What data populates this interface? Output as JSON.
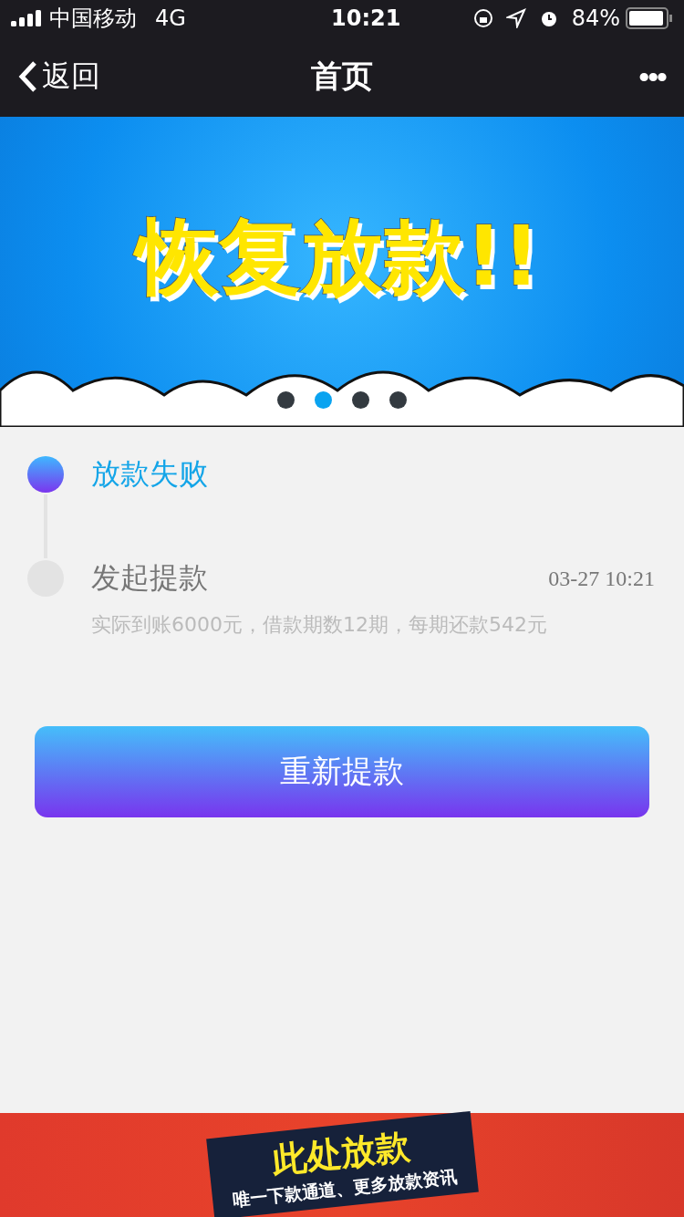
{
  "status_bar": {
    "carrier": "中国移动",
    "network": "4G",
    "time": "10:21",
    "battery": "84%"
  },
  "nav": {
    "back": "返回",
    "title": "首页",
    "more": "•••"
  },
  "banner": {
    "headline": "恢复放款!!",
    "dots": [
      {
        "selected": false
      },
      {
        "selected": true
      },
      {
        "selected": false
      },
      {
        "selected": false
      }
    ]
  },
  "timeline": [
    {
      "title": "放款失败",
      "active": true
    },
    {
      "title": "发起提款",
      "active": false,
      "time": "03-27 10:21",
      "detail": "实际到账6000元，借款期数12期，每期还款542元"
    }
  ],
  "button": "重新提款",
  "ad": {
    "headline": "此处放款",
    "subtitle": "唯一下款通道、更多放款资讯"
  }
}
